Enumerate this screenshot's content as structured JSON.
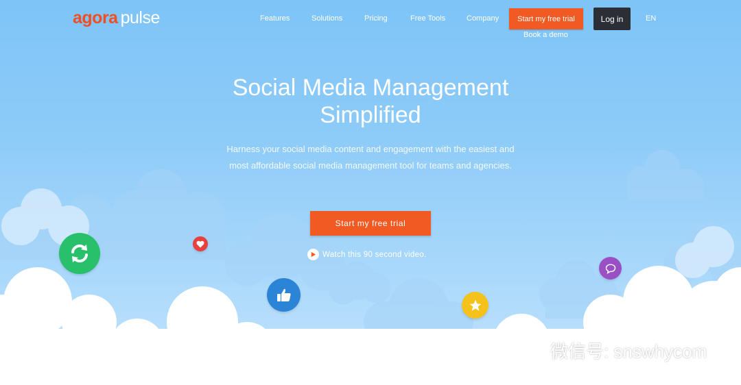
{
  "brand": {
    "part1": "agora",
    "part2": "pulse",
    "accent": "#f04e23"
  },
  "nav": {
    "items": [
      "Features",
      "Solutions",
      "Pricing",
      "Free Tools",
      "Company"
    ],
    "trial_button": "Start my free trial",
    "demo_link": "Book a demo",
    "login_button": "Log in",
    "language": "EN"
  },
  "hero": {
    "title_line1": "Social Media Management",
    "title_line2": "Simplified",
    "subtitle": "Harness your social media content and engagement with the easiest and most affordable social media management tool for teams and agencies.",
    "cta": "Start my free trial",
    "video_link": "Watch this 90 second video."
  },
  "icons": [
    "sync-icon",
    "heart-icon",
    "thumbs-up-icon",
    "star-icon",
    "chat-icon",
    "play-icon"
  ],
  "colors": {
    "orange": "#f15a22",
    "login_bg": "#2b2e34",
    "sync": "#28c06b",
    "heart": "#e6413f",
    "like": "#2b84d6",
    "star": "#f5c21b",
    "chat": "#9a4fc4"
  },
  "watermark": {
    "text": "微信号: snswhycom"
  }
}
